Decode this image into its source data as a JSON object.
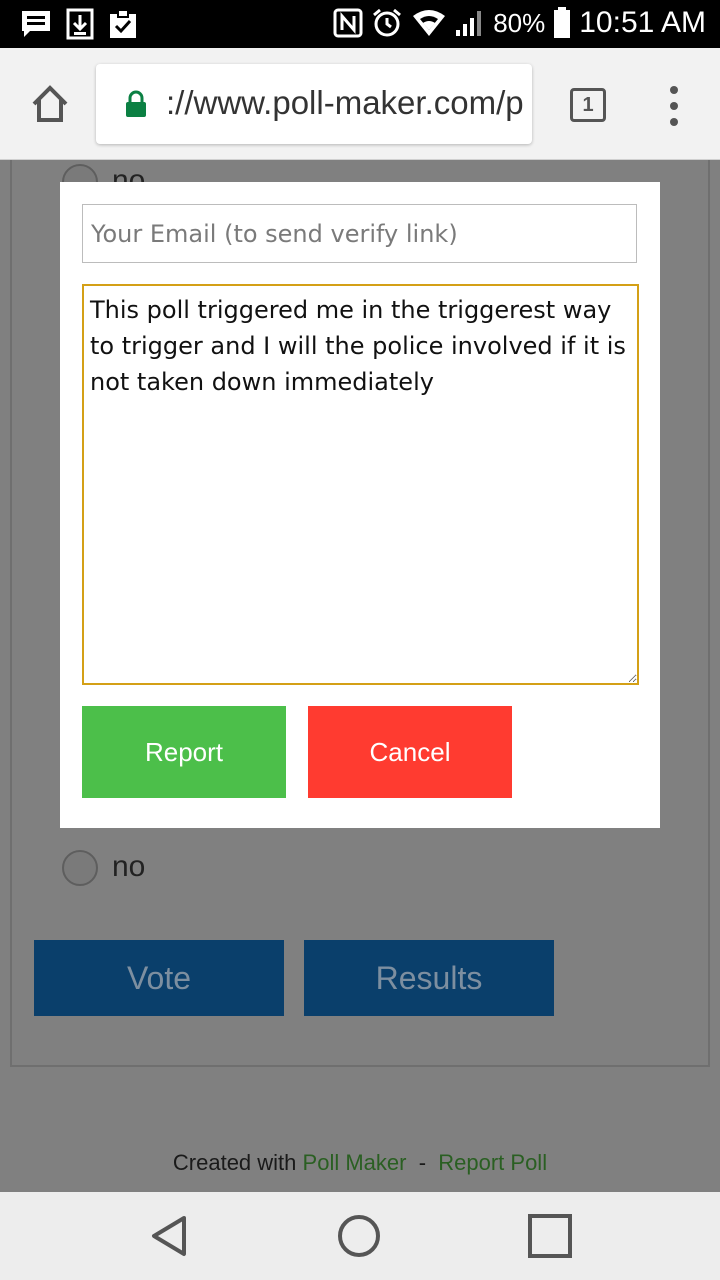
{
  "status_bar": {
    "battery_percent": "80%",
    "time": "10:51 AM",
    "icons": [
      "message-icon",
      "download-icon",
      "clipboard-check-icon",
      "nfc-icon",
      "alarm-icon",
      "wifi-icon",
      "signal-icon",
      "battery-icon"
    ]
  },
  "browser": {
    "url": "://www.poll-maker.com/p",
    "tab_count": "1"
  },
  "poll": {
    "top_option_label": "no",
    "option_label": "no",
    "vote_label": "Vote",
    "results_label": "Results"
  },
  "footer": {
    "created_with": "Created with",
    "poll_maker_link": "Poll Maker",
    "separator": "-",
    "report_poll_link": "Report Poll"
  },
  "modal": {
    "email_placeholder": "Your Email (to send verify link)",
    "email_value": "",
    "report_text": "This poll triggered me in the triggerest way to trigger and I will the police involved if it is not taken down immediately",
    "report_button": "Report",
    "cancel_button": "Cancel"
  },
  "colors": {
    "report_button": "#4cbf4a",
    "cancel_button": "#ff3b30",
    "textarea_border": "#d4a017",
    "dark_button": "#0a3f6b",
    "lock": "#0b8043",
    "footer_link": "#2a5f22"
  }
}
